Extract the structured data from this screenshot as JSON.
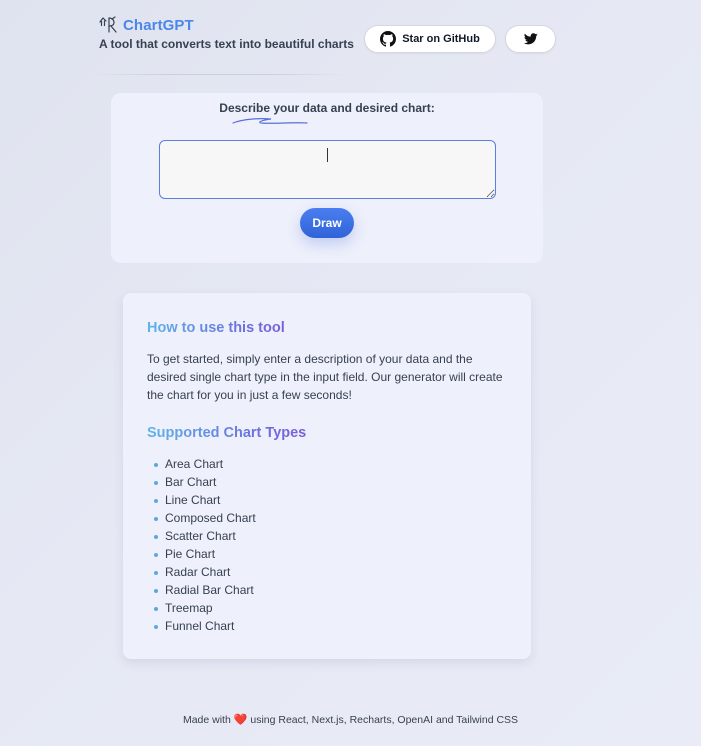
{
  "header": {
    "brand_name": "ChartGPT",
    "tagline": "A tool that converts text into beautiful charts",
    "github_label": "Star on GitHub"
  },
  "input_card": {
    "label": "Describe your data and desired chart:",
    "input_value": "",
    "draw_label": "Draw"
  },
  "info_card": {
    "howto_heading": "How to use this tool",
    "howto_body": "To get started, simply enter a description of your data and the desired single chart type in the input field. Our generator will create the chart for you in just a few seconds!",
    "types_heading": "Supported Chart Types",
    "chart_types": [
      "Area Chart",
      "Bar Chart",
      "Line Chart",
      "Composed Chart",
      "Scatter Chart",
      "Pie Chart",
      "Radar Chart",
      "Radial Bar Chart",
      "Treemap",
      "Funnel Chart"
    ]
  },
  "footer": {
    "prefix": "Made with",
    "heart": "❤️",
    "suffix": "using React, Next.js, Recharts, OpenAI and Tailwind CSS"
  },
  "icons": {
    "brand": "chart-logo-icon",
    "github": "github-icon",
    "twitter": "twitter-icon"
  },
  "colors": {
    "brand": "#4b86ea",
    "draw_button": "#3568de",
    "input_border": "#5b7fe0",
    "heading_gradient_start": "#5fb4e8",
    "heading_gradient_end": "#7b5fd9",
    "bullet": "#5fa8de"
  }
}
